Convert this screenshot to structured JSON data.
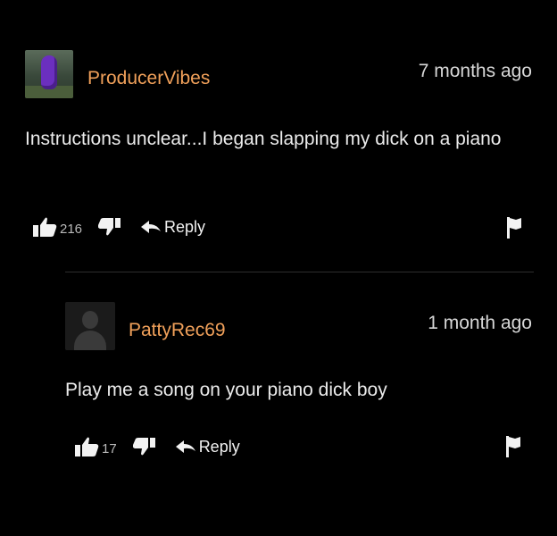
{
  "comments": [
    {
      "username": "ProducerVibes",
      "time": "7 months ago",
      "text": "Instructions unclear...I began slapping my dick on a piano",
      "likes": "216",
      "reply_label": "Reply"
    },
    {
      "username": "PattyRec69",
      "time": "1 month ago",
      "text": "Play me a song on your piano dick boy",
      "likes": "17",
      "reply_label": "Reply"
    }
  ],
  "colors": {
    "background": "#000000",
    "username": "#f0a05a",
    "text": "#ececec",
    "meta": "#d8d8d8"
  },
  "icons": [
    "thumbs-up-icon",
    "thumbs-down-icon",
    "reply-arrow-icon",
    "flag-icon"
  ]
}
